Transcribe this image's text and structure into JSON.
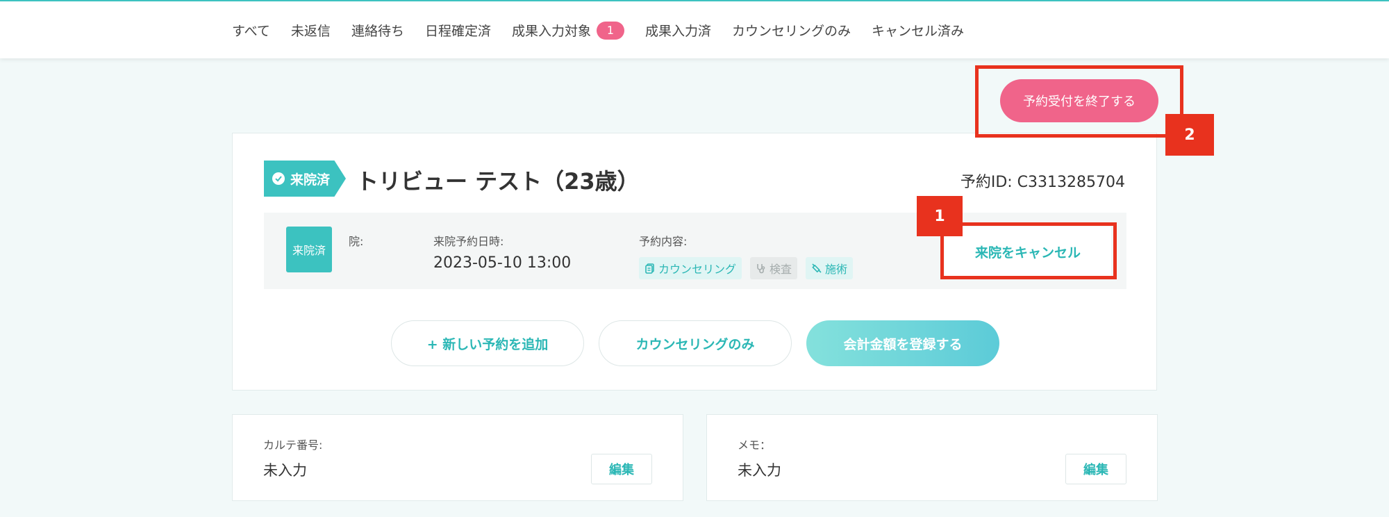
{
  "tabs": [
    {
      "label": "すべて"
    },
    {
      "label": "未返信"
    },
    {
      "label": "連絡待ち"
    },
    {
      "label": "日程確定済"
    },
    {
      "label": "成果入力対象",
      "badge": "1"
    },
    {
      "label": "成果入力済"
    },
    {
      "label": "カウンセリングのみ"
    },
    {
      "label": "キャンセル済み"
    }
  ],
  "end_button_label": "予約受付を終了する",
  "card": {
    "status_flag": "来院済",
    "patient_name": "トリビュー テスト（23歳）",
    "reservation_id": "予約ID: C3313285704",
    "detail": {
      "badge": "来院済",
      "clinic_label": "院:",
      "datetime_label": "来院予約日時:",
      "datetime_value": "2023-05-10 13:00",
      "content_label": "予約内容:",
      "chips": [
        {
          "label": "カウンセリング",
          "active": true,
          "icon": "document-icon"
        },
        {
          "label": "検査",
          "active": false,
          "icon": "stethoscope-icon"
        },
        {
          "label": "施術",
          "active": true,
          "icon": "syringe-icon"
        }
      ]
    },
    "cancel_visit_label": "来院をキャンセル",
    "actions": {
      "add_reservation": "+ 新しい予約を追加",
      "counseling_only": "カウンセリングのみ",
      "register_amount": "会計金額を登録する"
    }
  },
  "chart_card": {
    "label": "カルテ番号:",
    "value": "未入力",
    "edit": "編集"
  },
  "memo_card": {
    "label": "メモ：",
    "value": "未入力",
    "edit": "編集"
  },
  "annotations": {
    "one": "1",
    "two": "2"
  },
  "colors": {
    "accent": "#3cc2c0",
    "pink": "#f0648a",
    "annotation": "#e8321e"
  }
}
